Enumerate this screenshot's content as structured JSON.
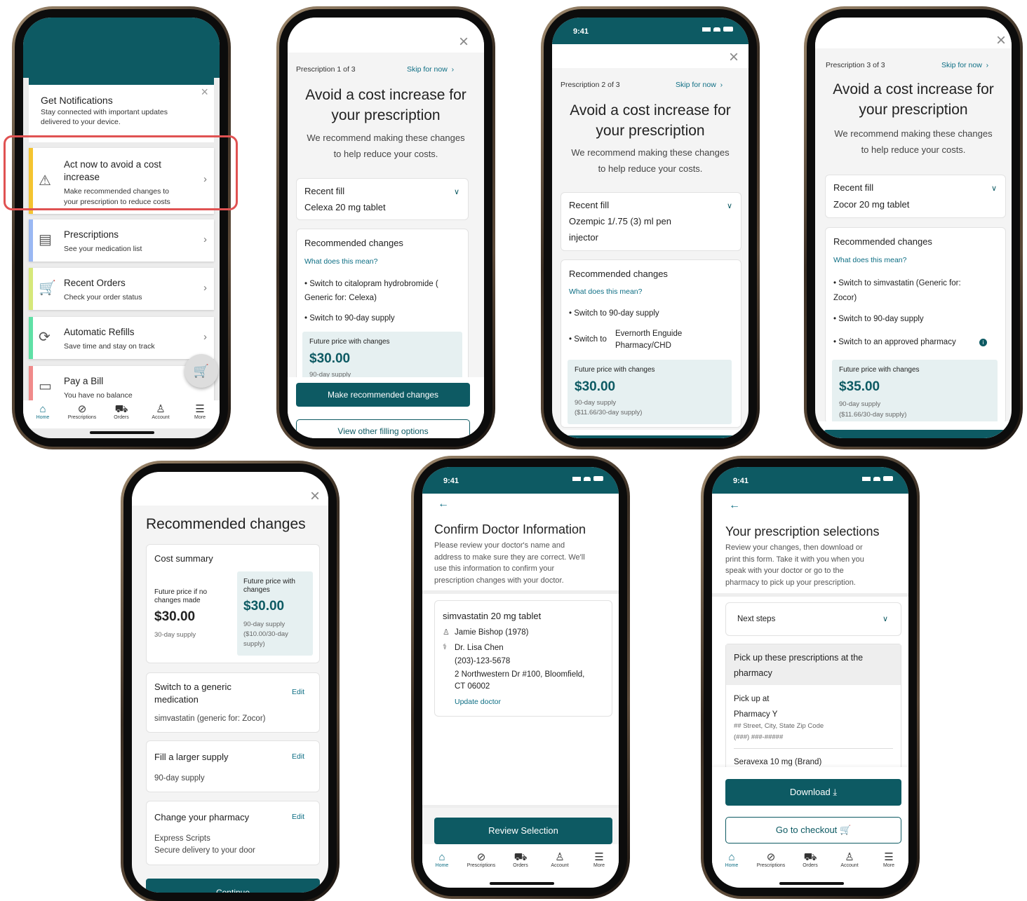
{
  "p1": {
    "notif_title": "Get Notifications",
    "notif_sub1": "Stay connected with important updates",
    "notif_sub2": "delivered to your device.",
    "tiles": [
      {
        "title1": "Act now to avoid a cost",
        "title2": "increase",
        "sub1": "Make recommended changes to",
        "sub2": "your prescription to reduce costs",
        "color": "#f4c430",
        "icon": "warning-icon"
      },
      {
        "title1": "Prescriptions",
        "sub1": "See your medication list",
        "color": "#9ab8f3",
        "icon": "pill-bottle-icon"
      },
      {
        "title1": "Recent Orders",
        "sub1": "Check your order status",
        "color": "#d6e87a",
        "icon": "cart-icon"
      },
      {
        "title1": "Automatic Refills",
        "sub1": "Save time and stay on track",
        "color": "#5fe0a6",
        "icon": "refill-icon"
      },
      {
        "title1": "Pay a Bill",
        "sub1": "You have no balance",
        "color": "#f08a8a",
        "icon": "wallet-icon"
      }
    ],
    "highlight_color": "#e05252"
  },
  "nav": [
    {
      "label": "Home",
      "icon": "home-icon"
    },
    {
      "label": "Prescriptions",
      "icon": "pill-icon"
    },
    {
      "label": "Orders",
      "icon": "truck-icon"
    },
    {
      "label": "Account",
      "icon": "account-icon"
    },
    {
      "label": "More",
      "icon": "menu-icon"
    }
  ],
  "status_time": "9:41",
  "common": {
    "headline1": "Avoid a cost increase for",
    "headline2": "your prescription",
    "intro1": "We recommend making these changes",
    "intro2": "to help reduce your costs.",
    "skip": "Skip for now",
    "recent_fill": "Recent fill",
    "rec_changes": "Recommended changes",
    "what_mean": "What does this mean?",
    "future_price": "Future price with changes",
    "switch_90": "• Switch to 90-day supply"
  },
  "p2": {
    "counter": "Prescription 1 of 3",
    "drug": "Celexa 20 mg tablet",
    "change1a": "• Switch to citalopram hydrobromide (",
    "change1b": "Generic for: Celexa)",
    "price": "$30.00",
    "supply": "90-day supply",
    "primary_btn": "Make recommended changes",
    "secondary_btn": "View other filling options"
  },
  "p3": {
    "counter": "Prescription 2 of 3",
    "drug1": "Ozempic 1/.75 (3) ml pen",
    "drug2": "injector",
    "change2a": "• Switch to",
    "change2b": "Evernorth Enguide",
    "change2c": "Pharmacy/CHD",
    "price": "$30.00",
    "supply1": "90-day supply",
    "supply2": "($11.66/30-day supply)"
  },
  "p4": {
    "counter": "Prescription 3 of 3",
    "drug": "Zocor 20 mg tablet",
    "change1a": "• Switch to simvastatin (Generic for:",
    "change1b": "Zocor)",
    "change3": "• Switch to an approved pharmacy",
    "price": "$35.00",
    "supply1": "90-day supply",
    "supply2": "($11.66/30-day supply)"
  },
  "p5": {
    "title": "Recommended changes",
    "cost_summary": "Cost summary",
    "np_label1": "Future price if no",
    "np_label2": "changes made",
    "np_price": "$30.00",
    "np_supply": "30-day supply",
    "fp_label1": "Future price with",
    "fp_label2": "changes",
    "fp_price": "$30.00",
    "fp_s1": "90-day supply",
    "fp_s2": "($10.00/30-day",
    "fp_s3": "supply)",
    "edit": "Edit",
    "s1_t1": "Switch to a generic",
    "s1_t2": "medication",
    "s1_d": "simvastatin (generic for: Zocor)",
    "s2_t": "Fill a larger supply",
    "s2_d": "90-day supply",
    "s3_t": "Change your pharmacy",
    "s3_d1": "Express Scripts",
    "s3_d2": "Secure delivery to your door",
    "btn": "Continue"
  },
  "p6": {
    "title": "Confirm Doctor Information",
    "d1": "Please review your doctor's name and",
    "d2": "address to make sure they are correct. We'll",
    "d3": "use this information to confirm your",
    "d4": "prescription changes with your doctor.",
    "drug": "simvastatin 20 mg tablet",
    "patient": "Jamie Bishop (1978)",
    "doctor": "Dr. Lisa Chen",
    "phone": "(203)-123-5678",
    "addr1": "2 Northwestern Dr #100, Bloomfield,",
    "addr2": "CT 06002",
    "update": "Update doctor",
    "btn": "Review Selection"
  },
  "p7": {
    "title": "Your prescription selections",
    "d1": "Review your changes, then download or",
    "d2": "print this form. Take it with you when you",
    "d3": "speak with your doctor or go to the",
    "d4": "pharmacy to pick up your prescription.",
    "next": "Next steps",
    "pick1": "Pick up these prescriptions at the",
    "pick2": "pharmacy",
    "pickat": "Pick up at",
    "pharm": "Pharmacy Y",
    "street": "## Street, City, State Zip Code",
    "phone": "(###) ###-#####",
    "drug": "Seravexa 10 mg (Brand)",
    "download": "Download",
    "checkout": "Go to checkout"
  }
}
